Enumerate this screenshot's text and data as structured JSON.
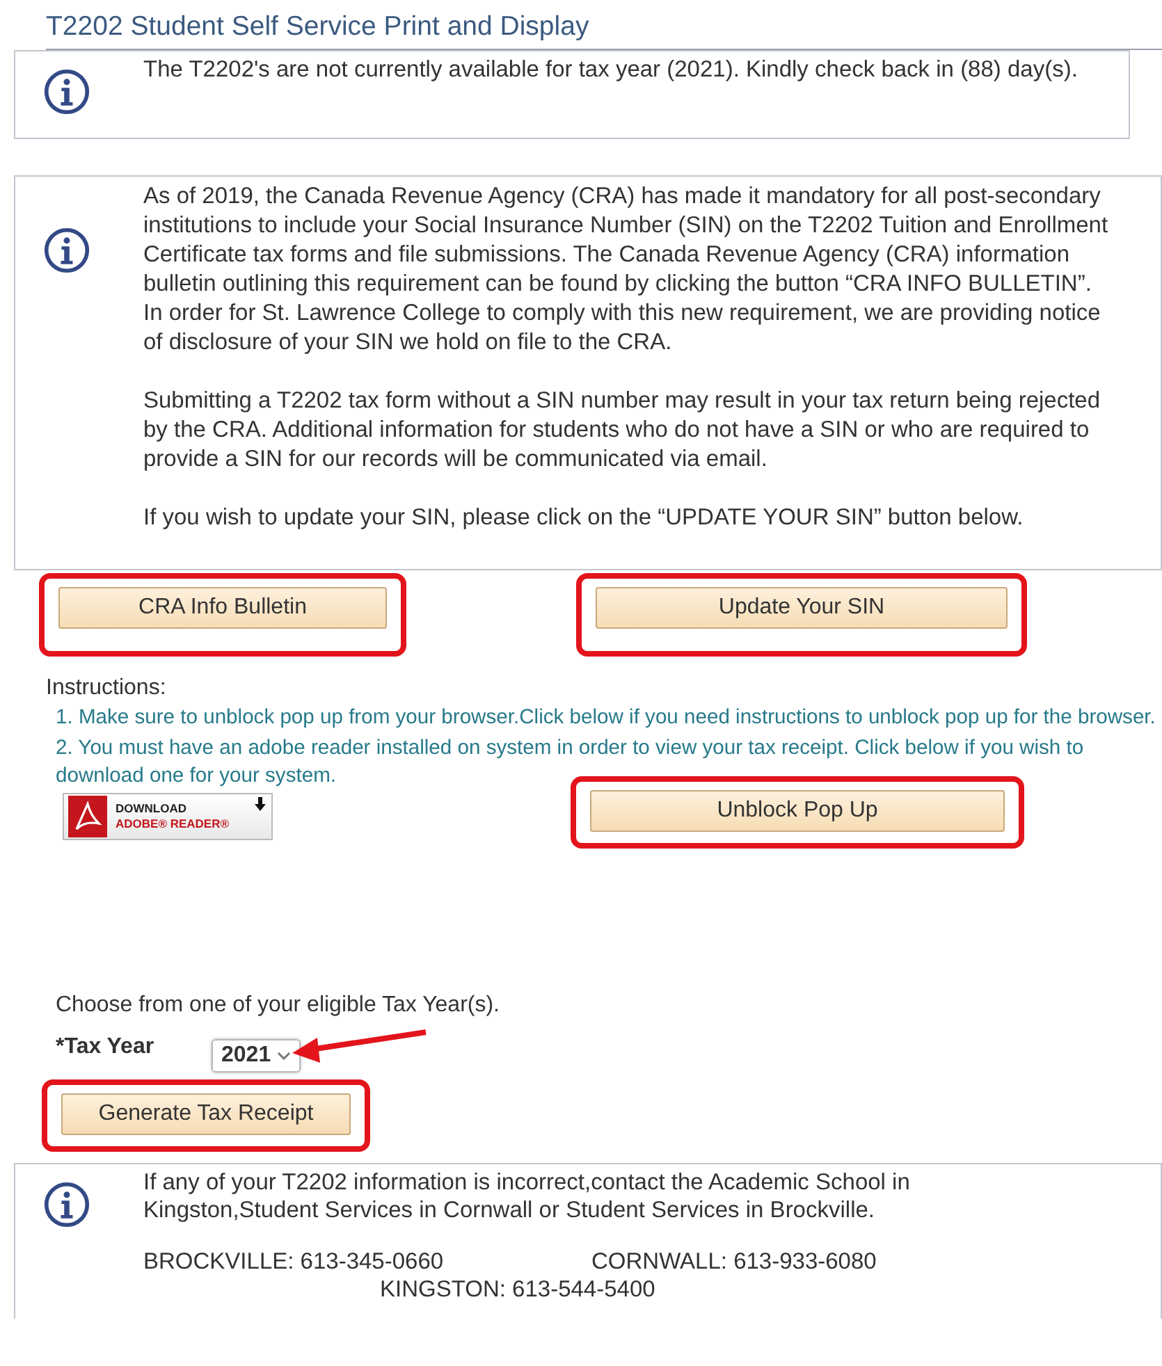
{
  "page_title": "T2202 Student Self Service Print and Display",
  "notice": {
    "lines": [
      "The T2202's are not currently available for tax year (2021). Kindly check back in (88) day(s)."
    ]
  },
  "disclosure": {
    "paragraphs": [
      "As of 2019, the Canada Revenue Agency (CRA) has made it mandatory for all post-secondary institutions to include your Social Insurance Number (SIN) on the T2202 Tuition and Enrollment Certificate tax forms and file submissions. The Canada Revenue Agency (CRA) information bulletin outlining this requirement can be found by clicking the button “CRA INFO BULLETIN”. In order for St. Lawrence College to comply with this new requirement, we are providing notice of disclosure of your SIN we hold on file to the CRA.",
      "Submitting a T2202 tax form without a SIN number may result in your tax return being rejected by the CRA.  Additional information for students who do not have a SIN or who are required to provide a SIN for our records will be communicated via email.",
      "If you wish to update your SIN, please click on the “UPDATE YOUR SIN” button below."
    ]
  },
  "sin_buttons": [
    {
      "label": "CRA Info Bulletin",
      "highlighted": true
    },
    {
      "label": "Update Your SIN",
      "highlighted": true
    }
  ],
  "instructions": {
    "heading": "Instructions:",
    "steps": [
      "1. Make sure to unblock pop up from your browser.Click below if you need instructions to unblock pop up for the browser.",
      "2. You must have an adobe reader installed on system in order to view your tax receipt. Click below if you wish to download one for your system."
    ],
    "adobe_badge": {
      "line1": "DOWNLOAD",
      "line2": "ADOBE® READER®"
    },
    "unblock_button": {
      "label": "Unblock Pop Up",
      "highlighted": true
    }
  },
  "tax_year": {
    "prompt": "Choose from one of your eligible Tax Year(s).",
    "label": "*Tax Year",
    "value": "2021",
    "arrow": true
  },
  "generate_button": {
    "label": "Generate Tax Receipt",
    "highlighted": true
  },
  "contact": {
    "text": "If any of your T2202 information is incorrect,contact the Academic School in Kingston,Student Services in Cornwall or Student Services in Brockville.",
    "phones": [
      "BROCKVILLE: 613-345-0660",
      "CORNWALL: 613-933-6080",
      "KINGSTON: 613-544-5400"
    ]
  }
}
